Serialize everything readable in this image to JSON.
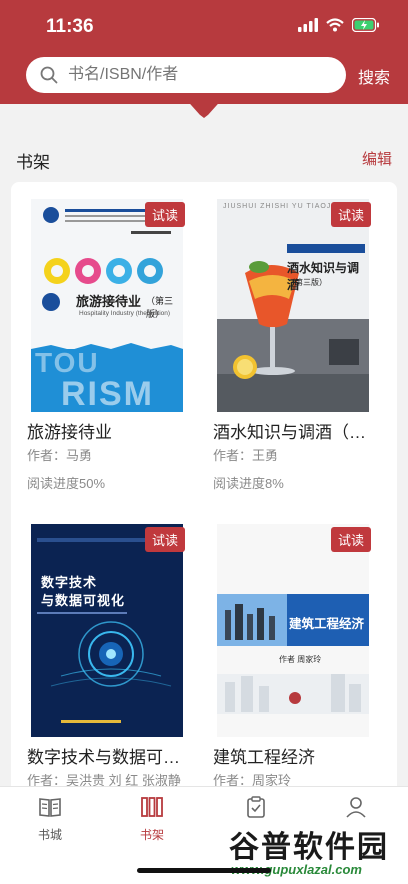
{
  "status": {
    "time": "11:36"
  },
  "search": {
    "placeholder": "书名/ISBN/作者",
    "button_label": "搜索"
  },
  "shelf": {
    "title": "书架",
    "edit_label": "编辑"
  },
  "books": [
    {
      "badge": "试读",
      "title": "旅游接待业",
      "author": "作者：马勇",
      "progress": "阅读进度50%",
      "cover": {
        "cover_title": "旅游接待业",
        "edition": "（第三版）",
        "subtitle": "Hospitality Industry (the edition)",
        "big_letters_1": "TOU",
        "big_letters_2": "RISM",
        "color": "#1f8fd6"
      }
    },
    {
      "badge": "试读",
      "title": "酒水知识与调酒（…",
      "author": "作者：王勇",
      "progress": "阅读进度8%",
      "cover": {
        "cover_title": "酒水知识与调酒",
        "edition": "（第三版）",
        "top_text": "JIUSHUI ZHISHI YU TIAOJIU",
        "color": "#d84a2a"
      }
    },
    {
      "badge": "试读",
      "title": "数字技术与数据可…",
      "author": "作者：吴洪贵 刘 红 张淑静",
      "cover": {
        "line1": "数字技术",
        "line2": "与数据可视化",
        "color": "#0d2a5e"
      }
    },
    {
      "badge": "试读",
      "title": "建筑工程经济",
      "author": "作者：周家玲",
      "cover": {
        "cover_title": "建筑工程经济",
        "author_line": "作者  周家玲",
        "color": "#1e5fb3"
      }
    }
  ],
  "tabs": [
    {
      "label": "书城",
      "icon": "book-open-icon",
      "active": false
    },
    {
      "label": "书架",
      "icon": "bookshelf-icon",
      "active": true
    },
    {
      "label": "",
      "icon": "clipboard-check-icon",
      "active": false
    },
    {
      "label": "",
      "icon": "user-icon",
      "active": false
    }
  ],
  "watermark": {
    "text": "谷普软件园",
    "url": "www.gupuxlazal.com"
  },
  "colors": {
    "brand": "#b73a3e",
    "badge": "#c0393d"
  }
}
